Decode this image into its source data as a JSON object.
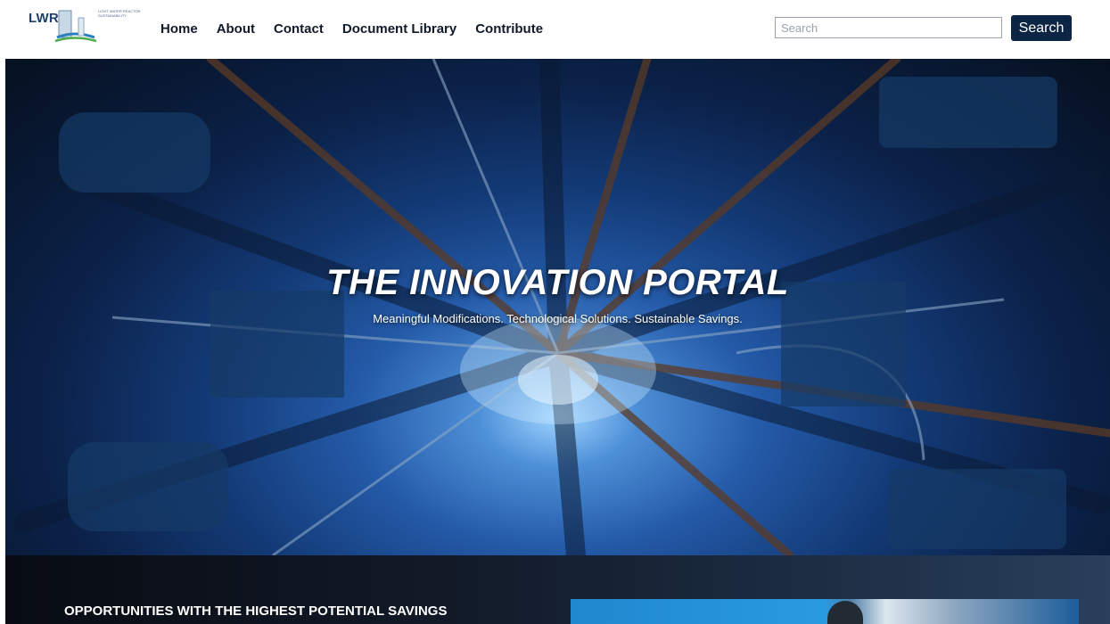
{
  "navbar": {
    "logo_text": "LWRS",
    "logo_subtext": "LIGHT WATER REACTOR SUSTAINABILITY",
    "links": [
      {
        "label": "Home"
      },
      {
        "label": "About"
      },
      {
        "label": "Contact"
      },
      {
        "label": "Document Library"
      },
      {
        "label": "Contribute"
      }
    ],
    "search": {
      "placeholder": "Search",
      "value": "",
      "button_label": "Search"
    }
  },
  "hero": {
    "title": "THE INNOVATION PORTAL",
    "subtitle": "Meaningful Modifications. Technological Solutions. Sustainable Savings."
  },
  "opportunities": {
    "heading": "OPPORTUNITIES WITH THE HIGHEST POTENTIAL SAVINGS"
  },
  "colors": {
    "search_button_bg": "#0d2544",
    "hero_core": "#9fd4ff",
    "hero_dark": "#06101f",
    "logo_blue": "#1d3f6a"
  }
}
